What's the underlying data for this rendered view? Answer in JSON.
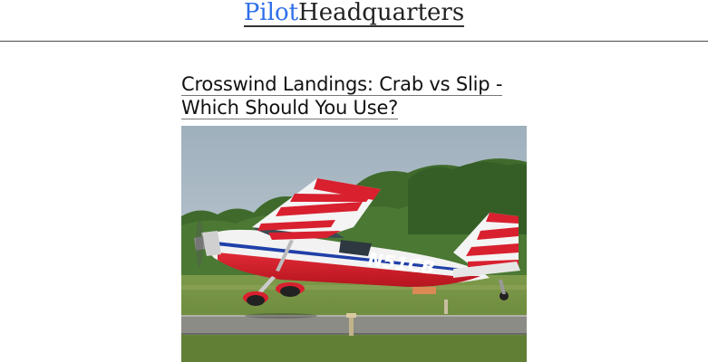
{
  "site": {
    "logo_part1": "Pilot",
    "logo_part2": "Headquarters"
  },
  "article": {
    "title_line1": "Crosswind Landings: Crab vs Slip -",
    "title_line2": "Which Should You Use?",
    "image": {
      "kind": "photo",
      "subject": "red-and-white-high-wing-airplane-landing",
      "tail_number": "N51CB"
    }
  },
  "colors": {
    "logo_accent": "#2f6fea",
    "logo_dark": "#222222",
    "header_rule": "#4a4a4a",
    "plane_red": "#d8202f",
    "sky": "#a9b8c3",
    "grass": "#6e8a3c"
  }
}
